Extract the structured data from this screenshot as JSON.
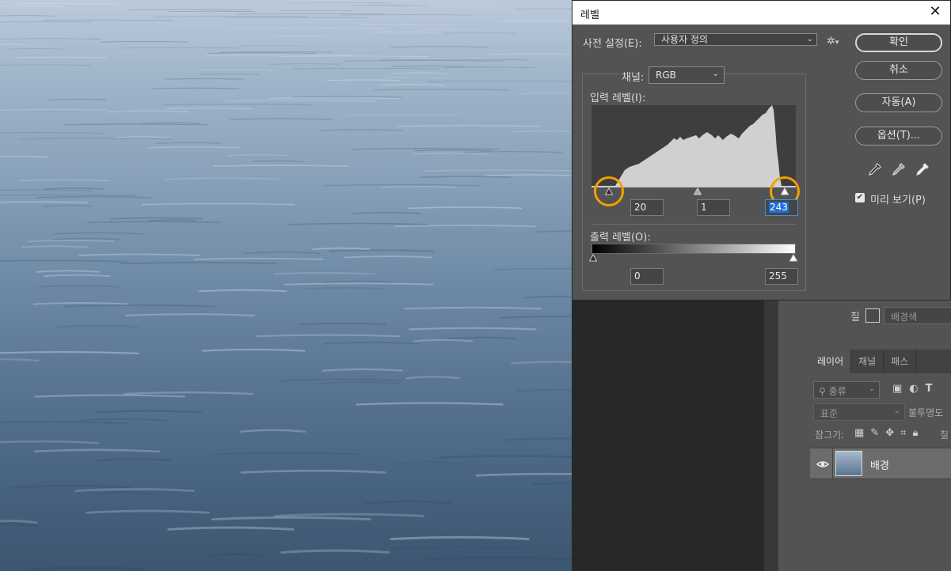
{
  "dialog": {
    "title": "레벨",
    "preset_label": "사전 설정(E):",
    "preset_value": "사용자 정의",
    "channel_label": "채널:",
    "channel_value": "RGB",
    "input_levels_label": "입력 레벨(I):",
    "input_black": "20",
    "input_gamma": "1",
    "input_white": "243",
    "output_levels_label": "출력 레벨(O):",
    "output_black": "0",
    "output_white": "255",
    "buttons": {
      "ok": "확인",
      "cancel": "취소",
      "auto": "자동(A)",
      "options": "옵션(T)..."
    },
    "preview_label": "미리 보기(P)",
    "preview_checked": true,
    "highlight_color": "#f59f00"
  },
  "properties": {
    "fill_label": "칠",
    "fill_value": "배경색"
  },
  "layers_panel": {
    "tabs": [
      "레이어",
      "채널",
      "패스"
    ],
    "kind_filter": "종류",
    "blend_mode": "표준",
    "opacity_label": "불투명도",
    "lock_label": "잠그기:",
    "layer_name": "배경"
  },
  "icons": {
    "close": "close-icon",
    "gear": "gear-icon",
    "eyedroppers": [
      "black-eyedropper-icon",
      "gray-eyedropper-icon",
      "white-eyedropper-icon"
    ],
    "eye": "eye-icon"
  }
}
